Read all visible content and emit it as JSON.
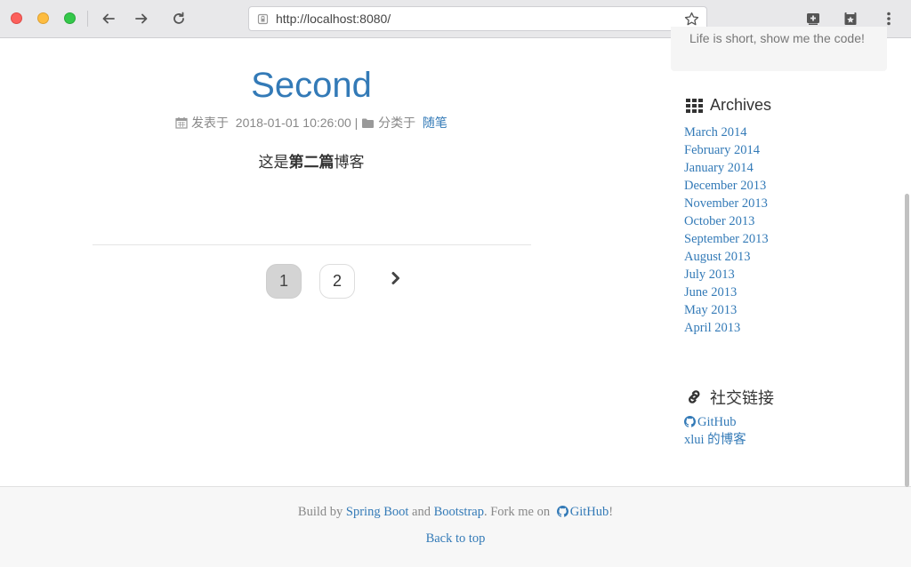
{
  "browser": {
    "url": "http://localhost:8080/"
  },
  "post": {
    "title": "Second",
    "meta_posted_label": "发表于",
    "meta_date": "2018-01-01 10:26:00",
    "meta_divider": "|",
    "meta_category_label": "分类于",
    "meta_category": "随笔",
    "body_prefix": "这是",
    "body_bold": "第二篇",
    "body_suffix": "博客"
  },
  "pagination": {
    "pages": [
      "1",
      "2"
    ],
    "current": "1"
  },
  "sidebar": {
    "about_text": "Life is short, show me the code!",
    "archives_title": "Archives",
    "archives": [
      "March 2014",
      "February 2014",
      "January 2014",
      "December 2013",
      "November 2013",
      "October 2013",
      "September 2013",
      "August 2013",
      "July 2013",
      "June 2013",
      "May 2013",
      "April 2013"
    ],
    "social_title": "社交链接",
    "social_links": [
      "GitHub",
      "xlui 的博客"
    ]
  },
  "footer": {
    "build_by": "Build by",
    "spring_boot": "Spring Boot",
    "and": "and",
    "bootstrap": "Bootstrap",
    "fork_me_on": ". Fork me on",
    "github": "GitHub",
    "exclaim": "!",
    "back_to_top": "Back to top"
  },
  "colors": {
    "link": "#337ab7",
    "muted": "#888888",
    "chrome": "#e8e8ea"
  }
}
